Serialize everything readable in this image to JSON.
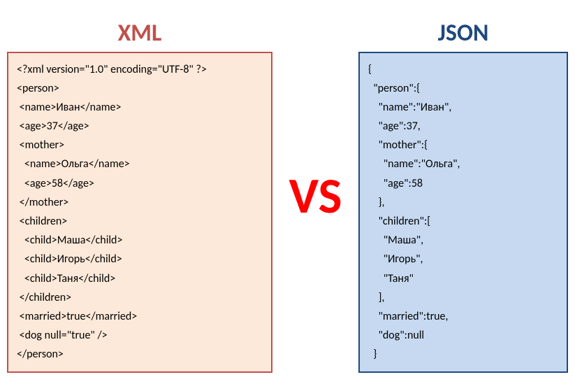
{
  "titles": {
    "xml": "XML",
    "json": "JSON",
    "vs": "VS"
  },
  "xml_code": "<?xml version=\"1.0\" encoding=\"UTF-8\" ?>\n<person>\n <name>Иван</name>\n <age>37</age>\n <mother>\n   <name>Ольга</name>\n   <age>58</age>\n </mother>\n <children>\n   <child>Маша</child>\n   <child>Игорь</child>\n   <child>Таня</child>\n </children>\n <married>true</married>\n <dog null=\"true\" />\n</person>",
  "json_code": "{\n  \"person\":{\n    \"name\":\"Иван\",\n    \"age\":37,\n    \"mother\":{\n      \"name\":\"Ольга\",\n      \"age\":58\n    },\n    \"children\":[\n      \"Маша\",\n      \"Игорь\",\n      \"Таня\"\n    ],\n    \"married\":true,\n    \"dog\":null\n  }"
}
